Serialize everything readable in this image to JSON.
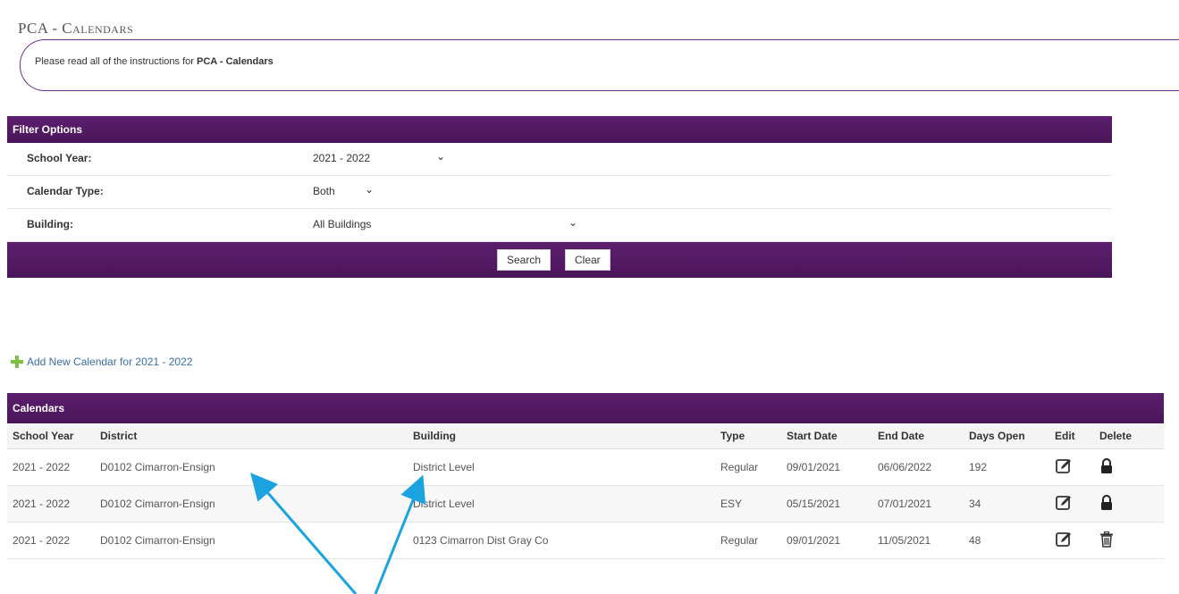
{
  "page": {
    "title": "PCA - Calendars",
    "instructions_prefix": "Please read all of the instructions for ",
    "instructions_bold": "PCA - Calendars"
  },
  "filter": {
    "header": "Filter Options",
    "school_year_label": "School Year:",
    "school_year_value": "2021 - 2022",
    "calendar_type_label": "Calendar Type:",
    "calendar_type_value": "Both",
    "building_label": "Building:",
    "building_value": "All Buildings",
    "search_label": "Search",
    "clear_label": "Clear"
  },
  "add_link": "Add New Calendar for 2021 - 2022",
  "calendars": {
    "header": "Calendars",
    "columns": [
      "School Year",
      "District",
      "Building",
      "Type",
      "Start Date",
      "End Date",
      "Days Open",
      "Edit",
      "Delete"
    ],
    "rows": [
      {
        "school_year": "2021 - 2022",
        "district": "D0102 Cimarron-Ensign",
        "building": "District Level",
        "type": "Regular",
        "start": "09/01/2021",
        "end": "06/06/2022",
        "days": "192",
        "delete_icon": "lock-icon"
      },
      {
        "school_year": "2021 - 2022",
        "district": "D0102 Cimarron-Ensign",
        "building": "District Level",
        "type": "ESY",
        "start": "05/15/2021",
        "end": "07/01/2021",
        "days": "34",
        "delete_icon": "lock-icon"
      },
      {
        "school_year": "2021 - 2022",
        "district": "D0102 Cimarron-Ensign",
        "building": "0123 Cimarron Dist Gray Co",
        "type": "Regular",
        "start": "09/01/2021",
        "end": "11/05/2021",
        "days": "48",
        "delete_icon": "trash-icon"
      }
    ]
  },
  "colors": {
    "accent_purple": "#5c1f6e",
    "annotation_arrow": "#1aa3e0",
    "add_icon": "#7cc242"
  }
}
